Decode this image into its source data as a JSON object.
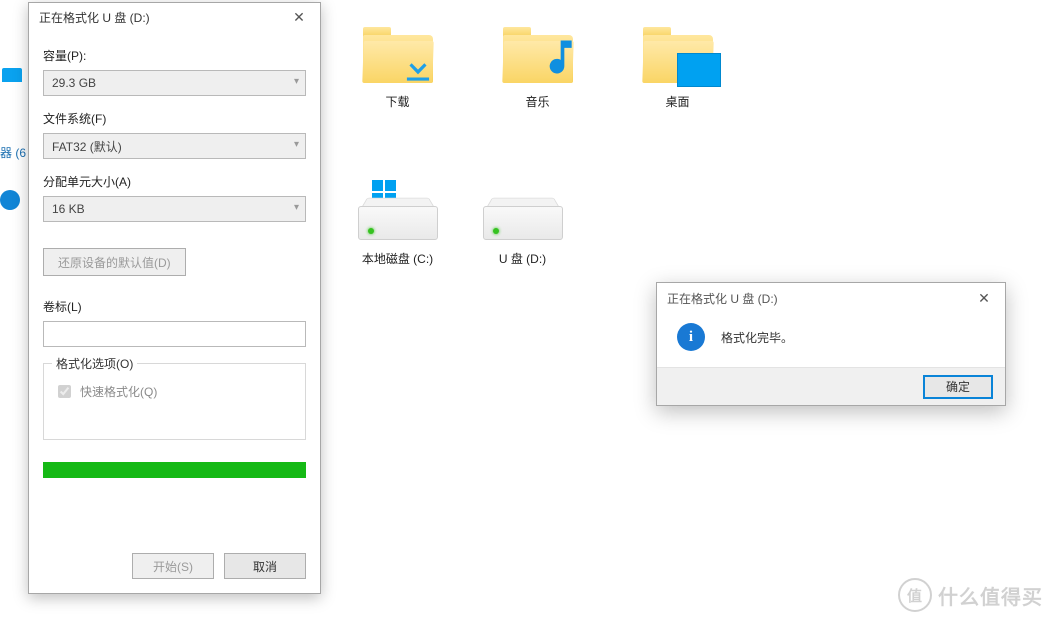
{
  "desktop": {
    "sidebar_text": "器 (6",
    "folders": [
      {
        "label": "下载"
      },
      {
        "label": "音乐"
      },
      {
        "label": "桌面"
      }
    ],
    "drives": [
      {
        "label": "本地磁盘 (C:)"
      },
      {
        "label": "U 盘 (D:)"
      }
    ]
  },
  "format_dialog": {
    "title": "正在格式化 U 盘 (D:)",
    "capacity": {
      "label": "容量(P):",
      "value": "29.3 GB"
    },
    "fs": {
      "label": "文件系统(F)",
      "value": "FAT32 (默认)"
    },
    "alloc": {
      "label": "分配单元大小(A)",
      "value": "16 KB"
    },
    "restore_defaults": "还原设备的默认值(D)",
    "volume": {
      "label": "卷标(L)",
      "value": ""
    },
    "options_group": "格式化选项(O)",
    "quick": {
      "label": "快速格式化(Q)",
      "checked": true
    },
    "progress_pct": 100,
    "start": "开始(S)",
    "cancel": "取消"
  },
  "msgbox": {
    "title": "正在格式化 U 盘 (D:)",
    "text": "格式化完毕。",
    "ok": "确定"
  },
  "watermark": {
    "badge": "值",
    "text": "什么值得买"
  }
}
